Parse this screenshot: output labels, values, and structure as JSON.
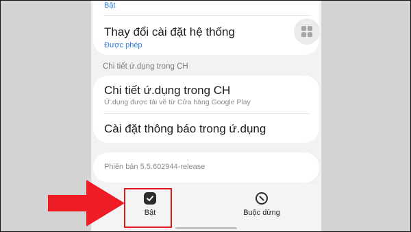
{
  "top_card": {
    "status_prev": "Bật",
    "title": "Thay đổi cài đặt hệ thống",
    "status": "Được phép"
  },
  "section_header": "Chi tiết ứ.dụng trong CH",
  "store_card": {
    "title": "Chi tiết ứ.dụng trong CH",
    "subtitle": "Ứ.dụng được tải về từ Cửa hàng Google Play",
    "notif_title": "Cài đặt thông báo trong ứ.dụng"
  },
  "version": "Phiên bản 5.5.602944-release",
  "bottom_bar": {
    "enable_label": "Bật",
    "force_stop_label": "Buộc dừng"
  },
  "colors": {
    "accent_blue": "#2f7bd8",
    "highlight_red": "#e3161b",
    "arrow_red": "#ee1c24"
  }
}
